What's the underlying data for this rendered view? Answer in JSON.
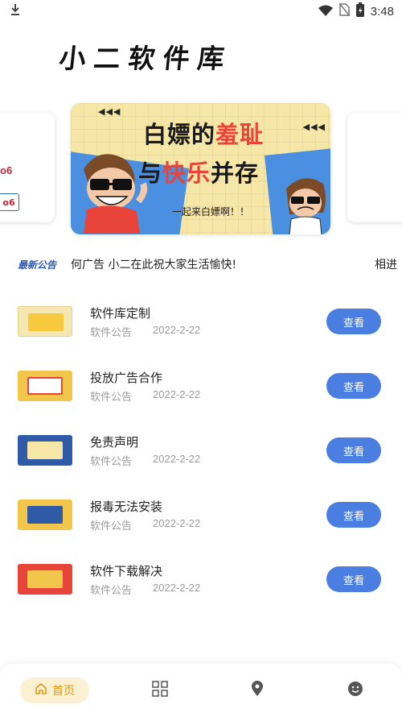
{
  "status_bar": {
    "time": "3:48",
    "icons": [
      "download-icon",
      "wifi-icon",
      "no-sim-icon",
      "battery-icon"
    ]
  },
  "app": {
    "title": "小二软件库"
  },
  "banner": {
    "headline_part1": "白嫖的",
    "headline_highlight1": "羞耻",
    "headline_part2": "与",
    "headline_highlight2": "快乐",
    "headline_part3": "并存",
    "tagline": "一起来白嫖啊！！",
    "left_peek_text_1": "o6",
    "left_peek_text_2": "o6"
  },
  "notice": {
    "badge": "最新公告",
    "text": "何广告 小二在此祝大家生活愉快!",
    "text_tail": "相进"
  },
  "announcements": [
    {
      "title": "软件库定制",
      "category": "软件公告",
      "date": "2022-2-22",
      "button": "查看",
      "thumb_bg": "#f5e7b2",
      "thumb_inner": "#f7c93f"
    },
    {
      "title": "投放广告合作",
      "category": "软件公告",
      "date": "2022-2-22",
      "button": "查看",
      "thumb_bg": "#f2c64a",
      "thumb_inner": "#e8443a"
    },
    {
      "title": "免责声明",
      "category": "软件公告",
      "date": "2022-2-22",
      "button": "查看",
      "thumb_bg": "#2e5aa8",
      "thumb_inner": "#f7e7a6"
    },
    {
      "title": "报毒无法安装",
      "category": "软件公告",
      "date": "2022-2-22",
      "button": "查看",
      "thumb_bg": "#f2c64a",
      "thumb_inner": "#f7e7a6"
    },
    {
      "title": "软件下载解决",
      "category": "软件公告",
      "date": "2022-2-22",
      "button": "查看",
      "thumb_bg": "#e8443a",
      "thumb_inner": "#2b2b2b"
    }
  ],
  "bottom_nav": {
    "home_label": "首页",
    "items": [
      "home-icon",
      "apps-grid-icon",
      "location-icon",
      "smiley-icon"
    ],
    "active_color": "#d99a12",
    "accent": "#4a7ee0"
  }
}
